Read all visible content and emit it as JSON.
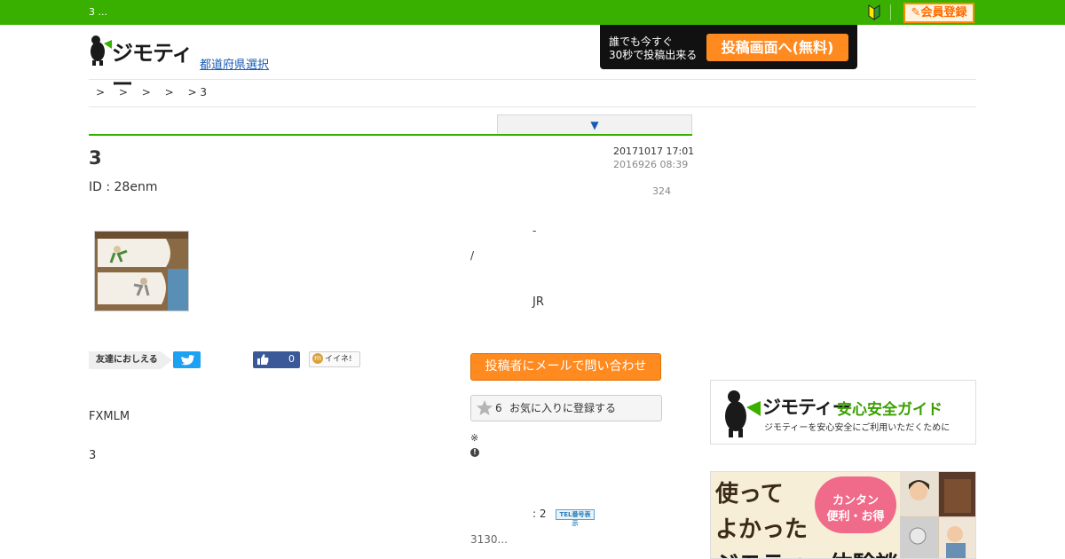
{
  "topbar": {
    "crumb": "3 ...",
    "register_label": "会員登録"
  },
  "header": {
    "logo_text": "ジモティー",
    "pref_link": "都道府県選択",
    "post_banner": {
      "line1": "誰でも今すぐ",
      "line2": "30秒で投稿出来る",
      "button": "投稿画面へ(無料)"
    }
  },
  "breadcrumb": [
    ">",
    ">",
    ">",
    ">",
    "> 3"
  ],
  "dropdown_arrow": "▼",
  "post": {
    "title": "3",
    "id": "ID : 28enm",
    "updated": "20171017 17:01",
    "posted": "2016926 08:39",
    "views": "324",
    "detail_dash": "-",
    "detail_slash": "/",
    "detail_jr": "JR",
    "body_line1": "FXMLM",
    "body_line2": "3"
  },
  "share": {
    "friends_label": "友達におしえる",
    "like_count": "0",
    "iine_label": "イイネ!"
  },
  "contact": {
    "mail_button": "投稿者にメールで問い合わせ",
    "fav_count": "6",
    "fav_label": "お気に入りに登録する",
    "note_mark": "※",
    "warn_glyph": "!",
    "tel_count": ": 2",
    "tel_badge": "TEL番号表示",
    "code_text": "3130..."
  },
  "guide_banner": {
    "logo": "ジモティー",
    "title": "安心安全ガイド",
    "subtitle": "ジモティーを安心安全にご利用いただくために"
  },
  "exp_banner": {
    "line1": "使って",
    "line2": "よかった",
    "line3": "ジモティー体験談",
    "bubble1": "カンタン",
    "bubble2": "便利・お得"
  },
  "colors": {
    "brand_green": "#39b000",
    "accent_orange": "#ff8a1f",
    "link_blue": "#1a5bb5"
  }
}
